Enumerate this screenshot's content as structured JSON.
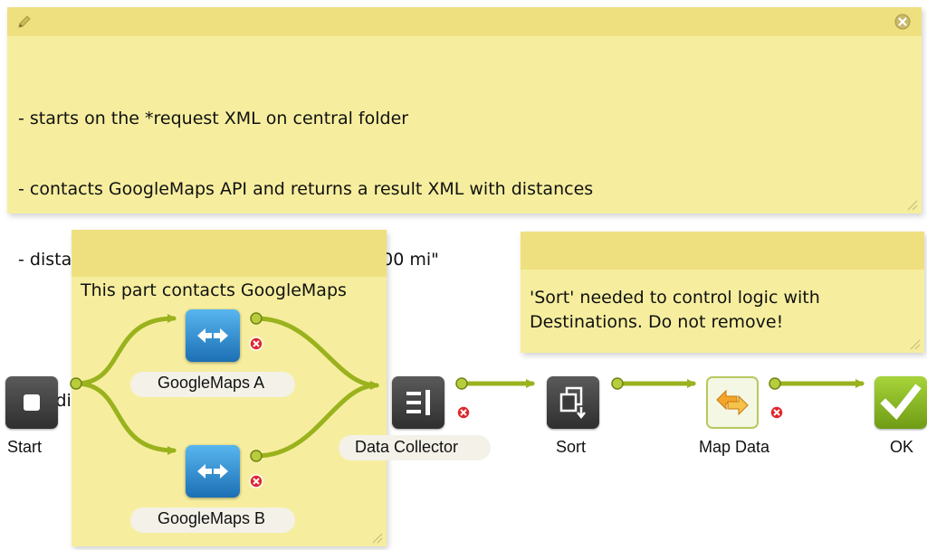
{
  "notes": {
    "top": {
      "icon": "pencil-icon",
      "close_icon": "close-icon",
      "lines": [
        "- starts on the *request XML on central folder",
        "- contacts GoogleMaps API and returns a result XML with distances",
        "- distances include the units - example: \"200 mi\"",
        "",
        "See different workflow for metric system"
      ]
    },
    "google": {
      "title": "This part contacts GoogleMaps"
    },
    "sort": {
      "lines": [
        "'Sort' needed to control logic with",
        "Destinations. Do not remove!"
      ]
    }
  },
  "nodes": {
    "start": {
      "label": "Start",
      "icon": "start-icon"
    },
    "googlemaps_a": {
      "label": "GoogleMaps A",
      "icon": "exchange-arrows-icon"
    },
    "googlemaps_b": {
      "label": "GoogleMaps B",
      "icon": "exchange-arrows-icon"
    },
    "data_collector": {
      "label": "Data Collector",
      "icon": "data-collector-icon"
    },
    "sort": {
      "label": "Sort",
      "icon": "sort-icon"
    },
    "map_data": {
      "label": "Map Data",
      "icon": "map-data-icon"
    },
    "ok": {
      "label": "OK",
      "icon": "checkmark-icon"
    }
  },
  "colors": {
    "note": "#f6ee9e",
    "note_header": "#efe07f",
    "connector": "#9ab21d",
    "error_dot": "#e0262b",
    "google_blue": "#2f8fd6",
    "ok_green": "#8dba22"
  }
}
